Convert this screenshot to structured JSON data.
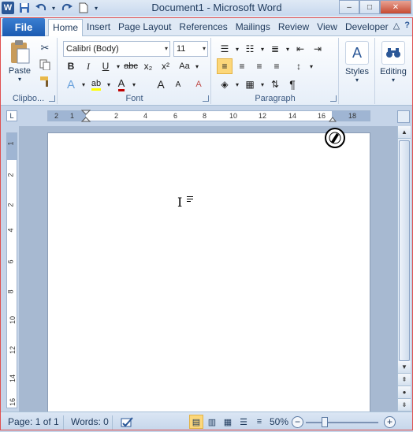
{
  "window": {
    "title": "Document1 - Microsoft Word",
    "app_logo": "W",
    "controls": {
      "minimize": "–",
      "maximize": "□",
      "close": "✕"
    }
  },
  "tabs": {
    "file": "File",
    "items": [
      "Home",
      "Insert",
      "Page Layout",
      "References",
      "Mailings",
      "Review",
      "View",
      "Developer"
    ],
    "active": "Home"
  },
  "ribbon": {
    "clipboard": {
      "label": "Clipbo...",
      "paste": "Paste"
    },
    "font": {
      "label": "Font",
      "family": "Calibri (Body)",
      "size": "11",
      "bold": "B",
      "italic": "I",
      "underline": "U",
      "strikethrough": "abc",
      "subscript": "x₂",
      "superscript": "x²",
      "grow": "A",
      "shrink": "A",
      "change_case": "Aa",
      "clear": "A"
    },
    "paragraph": {
      "label": "Paragraph",
      "show_marks": "¶"
    },
    "styles": {
      "label": "Styles"
    },
    "editing": {
      "label": "Editing"
    }
  },
  "ruler": {
    "horizontal_ticks": [
      "2",
      "1",
      "2",
      "4",
      "6",
      "8",
      "10",
      "12",
      "14",
      "16",
      "18"
    ],
    "vertical_ticks": [
      "1",
      "2",
      "2",
      "4",
      "6",
      "8",
      "10",
      "12",
      "14",
      "16"
    ]
  },
  "statusbar": {
    "page": "Page: 1 of 1",
    "words": "Words: 0",
    "zoom": "50%",
    "zoom_out": "−",
    "zoom_in": "+"
  },
  "colors": {
    "accent": "#2b5797",
    "highlight": "#fcd77a",
    "font_color": "#c00000"
  }
}
